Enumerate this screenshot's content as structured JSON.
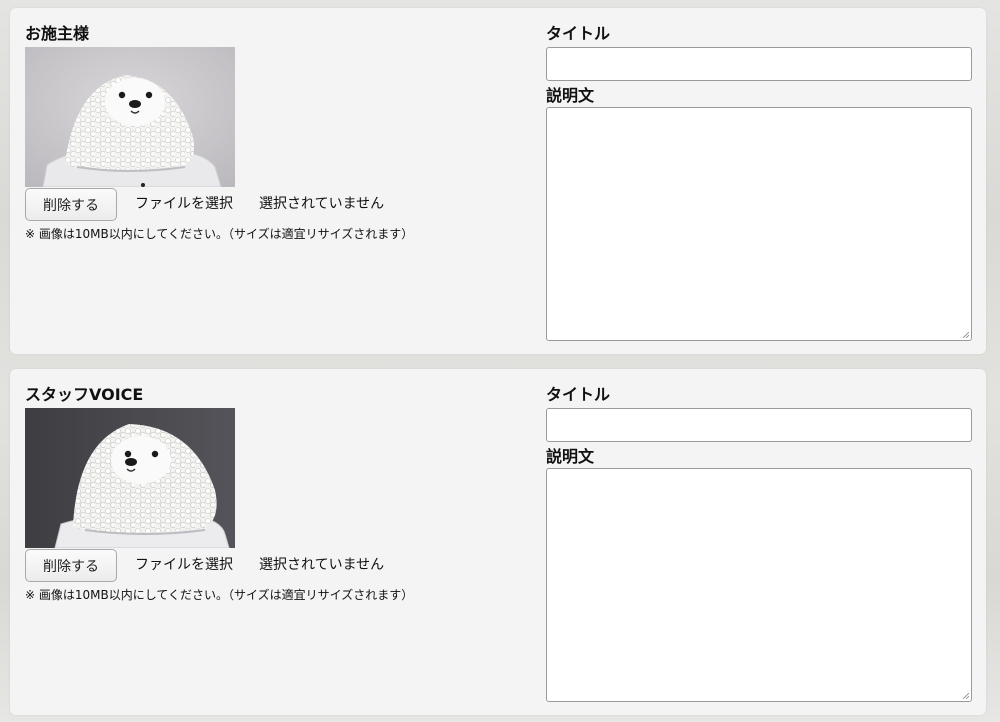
{
  "sections": [
    {
      "title": "お施主様",
      "delete_label": "削除する",
      "file_select_label": "ファイルを選択",
      "file_status": "選択されていません",
      "note": "※ 画像は10MB以内にしてください。（サイズは適宜リサイズされます）",
      "title_field_label": "タイトル",
      "title_value": "",
      "description_field_label": "説明文",
      "description_value": "",
      "photo_icon": "white-seal-plush-photo"
    },
    {
      "title": "スタッフVOICE",
      "delete_label": "削除する",
      "file_select_label": "ファイルを選択",
      "file_status": "選択されていません",
      "note": "※ 画像は10MB以内にしてください。（サイズは適宜リサイズされます）",
      "title_field_label": "タイトル",
      "title_value": "",
      "description_field_label": "説明文",
      "description_value": "",
      "photo_icon": "white-seal-plush-photo"
    }
  ],
  "colors": {
    "panel_bg": "#f4f4f4",
    "page_bg": "#dddddb",
    "input_border": "#9a9a9a"
  }
}
